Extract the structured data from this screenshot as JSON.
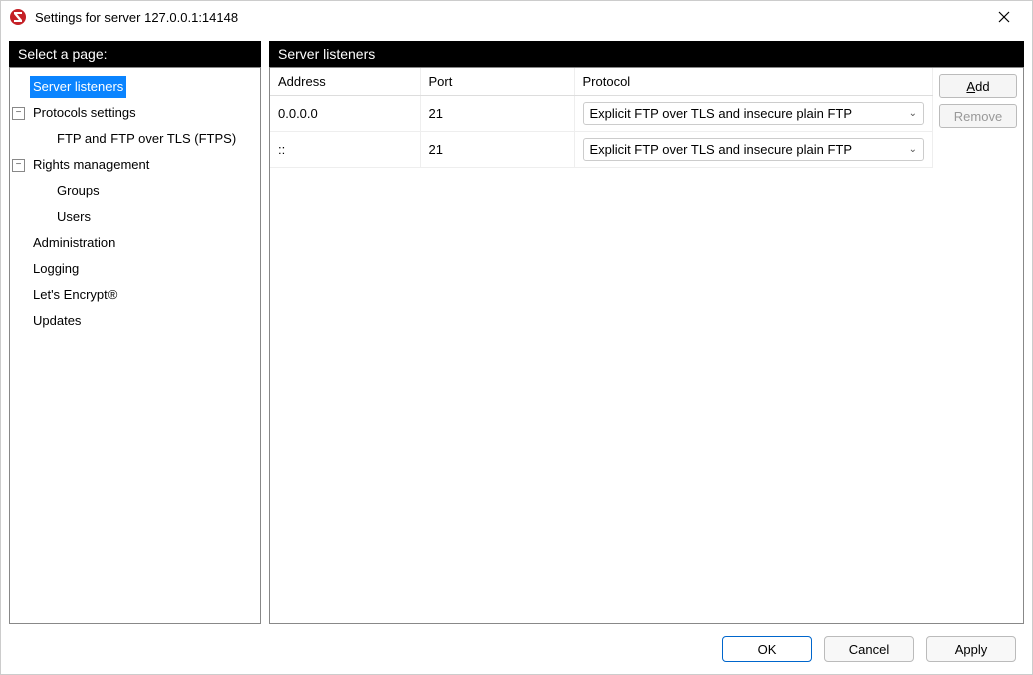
{
  "window": {
    "title": "Settings for server 127.0.0.1:14148"
  },
  "left": {
    "header": "Select a page:",
    "tree": [
      {
        "label": "Server listeners",
        "level": 0,
        "selected": true,
        "expander": null
      },
      {
        "label": "Protocols settings",
        "level": 0,
        "selected": false,
        "expander": "−"
      },
      {
        "label": "FTP and FTP over TLS (FTPS)",
        "level": 1,
        "selected": false,
        "expander": null
      },
      {
        "label": "Rights management",
        "level": 0,
        "selected": false,
        "expander": "−"
      },
      {
        "label": "Groups",
        "level": 1,
        "selected": false,
        "expander": null
      },
      {
        "label": "Users",
        "level": 1,
        "selected": false,
        "expander": null
      },
      {
        "label": "Administration",
        "level": 0,
        "selected": false,
        "expander": null
      },
      {
        "label": "Logging",
        "level": 0,
        "selected": false,
        "expander": null
      },
      {
        "label": "Let's Encrypt®",
        "level": 0,
        "selected": false,
        "expander": null
      },
      {
        "label": "Updates",
        "level": 0,
        "selected": false,
        "expander": null
      }
    ]
  },
  "right": {
    "header": "Server listeners",
    "columns": {
      "address": "Address",
      "port": "Port",
      "protocol": "Protocol"
    },
    "rows": [
      {
        "address": "0.0.0.0",
        "port": "21",
        "protocol": "Explicit FTP over TLS and insecure plain FTP"
      },
      {
        "address": "::",
        "port": "21",
        "protocol": "Explicit FTP over TLS and insecure plain FTP"
      }
    ],
    "buttons": {
      "add": "Add",
      "remove": "Remove"
    }
  },
  "footer": {
    "ok": "OK",
    "cancel": "Cancel",
    "apply": "Apply"
  }
}
